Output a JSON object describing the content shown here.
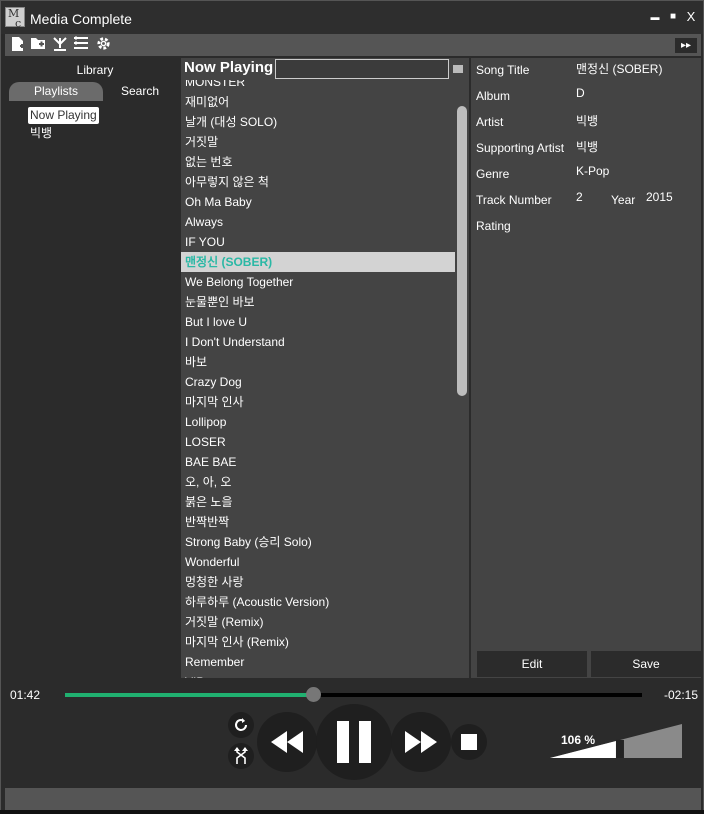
{
  "window": {
    "title": "Media Complete",
    "logo_text": "MC"
  },
  "title_buttons": {
    "minimize": "▬",
    "maximize": "■",
    "close": "X"
  },
  "toolbar": {
    "icons": [
      "new-file-icon",
      "new-folder-icon",
      "import-icon",
      "list-icon",
      "gear-icon"
    ],
    "skip": "▸▸"
  },
  "sidebar": {
    "library_label": "Library",
    "tabs": [
      "Playlists",
      "Search"
    ],
    "items": [
      "Now Playing",
      "빅뱅"
    ]
  },
  "now_playing": {
    "title": "Now Playing",
    "search_value": "",
    "current_track": "맨정신 (SOBER)",
    "tracks": [
      "MONSTER",
      "재미없어",
      "날개 (대성 SOLO)",
      "거짓말",
      "없는 번호",
      "아무렇지 않은 척",
      "Oh Ma Baby",
      "Always",
      "IF YOU",
      "맨정신 (SOBER)",
      "We Belong Together",
      "눈물뿐인 바보",
      "But I love U",
      "I Don't Understand",
      "바보",
      "Crazy Dog",
      "마지막 인사",
      "Lollipop",
      "LOSER",
      "BAE BAE",
      "오, 아, 오",
      "붉은 노을",
      "반짝반짝",
      "Strong Baby (승리 Solo)",
      "Wonderful",
      "멍청한 사랑",
      "하루하루 (Acoustic Version)",
      "거짓말 (Remix)",
      "마지막 인사 (Remix)",
      "Remember",
      "VIP"
    ]
  },
  "properties": {
    "song_title_label": "Song Title",
    "song_title": "맨정신 (SOBER)",
    "album_label": "Album",
    "album": "D",
    "artist_label": "Artist",
    "artist": "빅뱅",
    "supporting_artist_label": "Supporting Artist",
    "supporting_artist": "빅뱅",
    "genre_label": "Genre",
    "genre": "K-Pop",
    "track_number_label": "Track Number",
    "track_number": "2",
    "year_label": "Year",
    "year": "2015",
    "rating_label": "Rating",
    "edit_label": "Edit",
    "save_label": "Save"
  },
  "player": {
    "elapsed": "01:42",
    "remaining": "-02:15",
    "progress_fraction": 0.43,
    "volume_label": "106 %",
    "volume_fraction": 0.53,
    "accent_color": "#20b070",
    "highlight_color": "#2ab8a5"
  }
}
